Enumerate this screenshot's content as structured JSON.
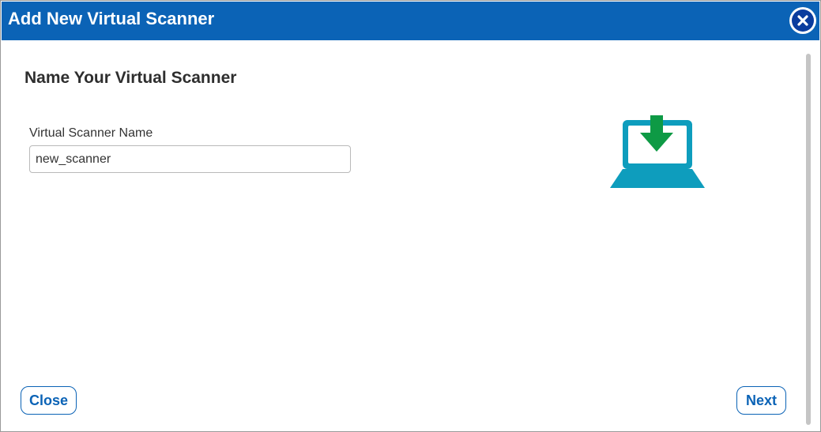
{
  "dialog": {
    "title": "Add New Virtual Scanner",
    "close_icon": "close-icon"
  },
  "form": {
    "heading": "Name Your Virtual Scanner",
    "name_label": "Virtual Scanner Name",
    "name_value": "new_scanner"
  },
  "illustration": {
    "icon": "laptop-download-icon",
    "colors": {
      "laptop": "#0e9dbd",
      "arrow": "#0e9a45"
    }
  },
  "footer": {
    "close_label": "Close",
    "next_label": "Next"
  },
  "colors": {
    "titlebar": "#0b63b6",
    "button_text": "#0b63b6"
  }
}
